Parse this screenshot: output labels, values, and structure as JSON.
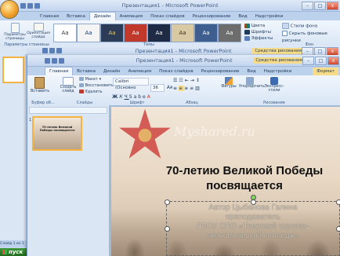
{
  "back_window": {
    "title": "Презентация1 - Microsoft PowerPoint",
    "tabs": [
      "Главная",
      "Вставка",
      "Дизайн",
      "Анимация",
      "Показ слайдов",
      "Рецензирование",
      "Вид",
      "Надстройки"
    ],
    "active_tab": "Дизайн",
    "buttons": {
      "page_setup": "Параметры страницы",
      "orientation": "Ориентация слайда",
      "colors": "Цвета",
      "fonts": "Шрифты",
      "effects": "Эффекты",
      "bg_styles": "Стили фона",
      "hide_bg": "Скрыть фоновые рисунки"
    },
    "group_labels": {
      "page_setup": "Параметры страницы",
      "themes": "Темы",
      "background": "Фон"
    },
    "theme_labels": [
      "Aa",
      "Aa",
      "Aa",
      "Aa",
      "Aa",
      "Aa",
      "Aa",
      "Aa"
    ]
  },
  "mid_window": {
    "title": "Презентация1 - Microsoft PowerPoint",
    "context_tab": "Средства рисования"
  },
  "front_window": {
    "title": "Презентация1 - Microsoft PowerPoint",
    "context_tab": "Средства рисования",
    "tabs": [
      "Главная",
      "Вставка",
      "Дизайн",
      "Анимация",
      "Показ слайдов",
      "Рецензирование",
      "Вид",
      "Надстройки",
      "Формат"
    ],
    "active_tab": "Главная",
    "home": {
      "paste": "Вставить",
      "new_slide": "Создать слайд",
      "layout": "Макет",
      "reset": "Восстановить",
      "delete": "Удалить",
      "font_name": "Calibri (Основно",
      "font_size": "36",
      "shapes": "Фигуры",
      "arrange": "Упорядочить",
      "quick_styles": "Экспресс-стили"
    },
    "group_labels": {
      "clipboard": "Буфер об...",
      "slides": "Слайды",
      "font": "Шрифт",
      "paragraph": "Абзац",
      "drawing": "Рисование"
    }
  },
  "thumbnail": {
    "number": "1",
    "title": "70-летию Великой Победы посвящается"
  },
  "slide": {
    "watermark": "Myshared.ru",
    "title": "70-летию Великой Победы посвящается",
    "subtitle_lines": [
      "Автор Цыбанова Галина",
      "преподаватель",
      "ГБОУ СПО «Тверской торгово-",
      "экономический колледж»"
    ]
  },
  "status": {
    "slide_counter": "Слайд 1 из 1"
  },
  "taskbar": {
    "start": "пуск"
  },
  "colors": {
    "accent": "#1e395b",
    "ribbon": "#dbe7f6",
    "office_orange": "#f2a22c"
  }
}
